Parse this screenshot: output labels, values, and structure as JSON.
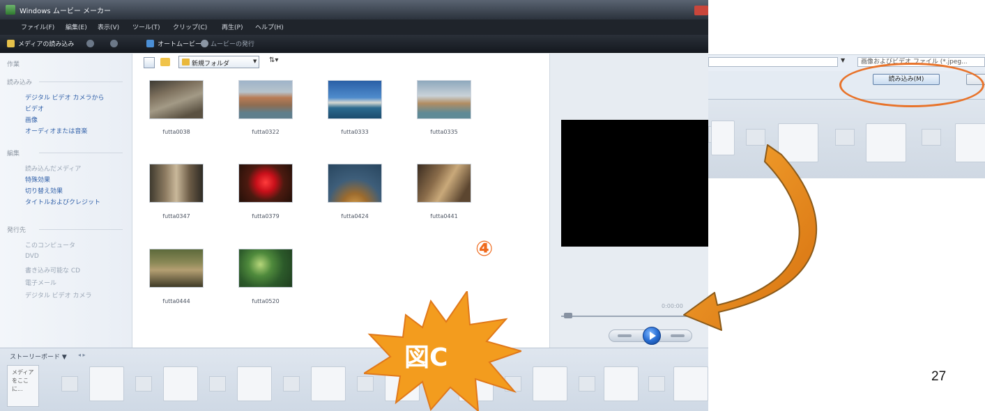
{
  "window": {
    "title": "Windows ムービー メーカー"
  },
  "menu": [
    "ファイル(F)",
    "編集(E)",
    "表示(V)",
    "ツール(T)",
    "クリップ(C)",
    "再生(P)",
    "ヘルプ(H)"
  ],
  "toolbar": {
    "import_media": "メディアの読み込み",
    "auto_movie": "オートムービー",
    "publish_movie": "ムービーの発行"
  },
  "tasks": {
    "header": "作業",
    "import_section": "読み込み",
    "import_links": [
      "デジタル ビデオ カメラから",
      "ビデオ",
      "画像",
      "オーディオまたは音楽"
    ],
    "edit_section": "編集",
    "edit_links": [
      "読み込んだメディア",
      "特殊効果",
      "切り替え効果",
      "タイトルおよびクレジット"
    ],
    "publish_section": "発行先",
    "publish_links": [
      "このコンピュータ",
      "DVD",
      "書き込み可能な CD",
      "電子メール",
      "デジタル ビデオ カメラ"
    ]
  },
  "collection": {
    "folder": "新規フォルダ",
    "items": [
      {
        "label": "futta0038"
      },
      {
        "label": "futta0322"
      },
      {
        "label": "futta0333"
      },
      {
        "label": "futta0335"
      },
      {
        "label": "futta0347"
      },
      {
        "label": "futta0379"
      },
      {
        "label": "futta0424"
      },
      {
        "label": "futta0441"
      },
      {
        "label": "futta0444"
      },
      {
        "label": "futta0520"
      }
    ]
  },
  "preview": {
    "time": "0:00:00"
  },
  "storyboard": {
    "label": "ストーリーボード ▼",
    "drop_hint": "メディアをここに..."
  },
  "inset": {
    "import_button": "読み込み(M)",
    "file_type_filter": "画像およびビデオ ファイル (*.jpeg..."
  },
  "annotations": {
    "step": "④",
    "figure_label": "図C",
    "page_number": "27"
  },
  "colors": {
    "accent_orange": "#ef8a1a",
    "highlight_oval": "#e8732a",
    "link_blue": "#2f5fa8"
  }
}
